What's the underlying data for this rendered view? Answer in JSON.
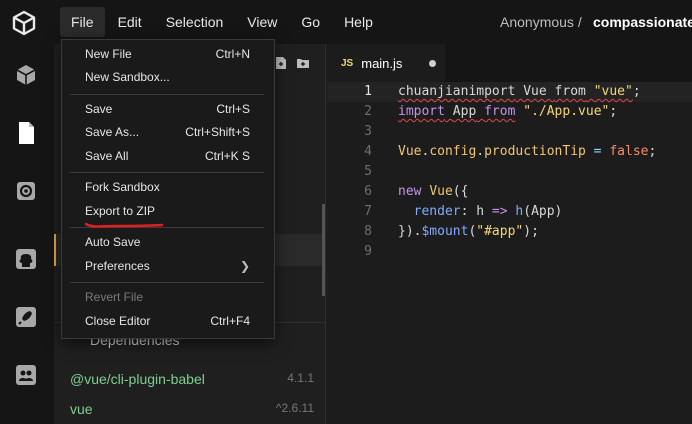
{
  "menubar": {
    "items": [
      "File",
      "Edit",
      "Selection",
      "View",
      "Go",
      "Help"
    ],
    "active": "File",
    "user": "Anonymous /",
    "sandbox": "compassionate-"
  },
  "activity": {
    "icons": [
      "cube-icon",
      "file-icon",
      "gear-icon",
      "github-icon",
      "rocket-icon",
      "users-icon"
    ]
  },
  "file_menu": {
    "new_file": {
      "label": "New File",
      "shortcut": "Ctrl+N"
    },
    "new_sandbox": {
      "label": "New Sandbox...",
      "shortcut": ""
    },
    "save": {
      "label": "Save",
      "shortcut": "Ctrl+S"
    },
    "save_as": {
      "label": "Save As...",
      "shortcut": "Ctrl+Shift+S"
    },
    "save_all": {
      "label": "Save All",
      "shortcut": "Ctrl+K S"
    },
    "fork_sandbox": {
      "label": "Fork Sandbox",
      "shortcut": ""
    },
    "export_zip": {
      "label": "Export to ZIP",
      "shortcut": ""
    },
    "auto_save": {
      "label": "Auto Save",
      "shortcut": ""
    },
    "preferences": {
      "label": "Preferences",
      "shortcut": ""
    },
    "revert_file": {
      "label": "Revert File",
      "shortcut": ""
    },
    "close_editor": {
      "label": "Close Editor",
      "shortcut": "Ctrl+F4"
    }
  },
  "sidebar": {
    "dependencies_title": "Dependencies",
    "dependencies": [
      {
        "name": "@vue/cli-plugin-babel",
        "version": "4.1.1"
      },
      {
        "name": "vue",
        "version": "^2.6.11"
      }
    ]
  },
  "editor": {
    "tab": {
      "icon": "JS",
      "label": "main.js"
    },
    "current_line": 1,
    "lines": [
      {
        "n": "1",
        "tokens": [
          {
            "t": "chuanjianimport",
            "c": "c-plain",
            "sq": true
          },
          {
            "t": " Vue ",
            "c": "c-plain",
            "sq": true
          },
          {
            "t": "from",
            "c": "c-plain",
            "sq": true
          },
          {
            "t": " ",
            "c": "c-plain",
            "sq": true
          },
          {
            "t": "\"vue\"",
            "c": "c-str",
            "sq": true
          },
          {
            "t": ";",
            "c": "c-plain"
          }
        ]
      },
      {
        "n": "2",
        "tokens": [
          {
            "t": "import",
            "c": "c-kw",
            "sq": true
          },
          {
            "t": " ",
            "c": "c-plain",
            "sq": true
          },
          {
            "t": "App",
            "c": "c-plain",
            "sq": true
          },
          {
            "t": " ",
            "c": "c-plain",
            "sq": true
          },
          {
            "t": "from",
            "c": "c-kw",
            "sq": true
          },
          {
            "t": " ",
            "c": "c-plain"
          },
          {
            "t": "\"./App.vue\"",
            "c": "c-str"
          },
          {
            "t": ";",
            "c": "c-plain"
          }
        ]
      },
      {
        "n": "3",
        "tokens": []
      },
      {
        "n": "4",
        "tokens": [
          {
            "t": "Vue",
            "c": "c-prop"
          },
          {
            "t": ".",
            "c": "c-plain"
          },
          {
            "t": "config",
            "c": "c-prop"
          },
          {
            "t": ".",
            "c": "c-plain"
          },
          {
            "t": "productionTip",
            "c": "c-prop"
          },
          {
            "t": " = ",
            "c": "c-op"
          },
          {
            "t": "false",
            "c": "c-lit"
          },
          {
            "t": ";",
            "c": "c-plain"
          }
        ]
      },
      {
        "n": "5",
        "tokens": []
      },
      {
        "n": "6",
        "tokens": [
          {
            "t": "new",
            "c": "c-kw"
          },
          {
            "t": " ",
            "c": "c-plain"
          },
          {
            "t": "Vue",
            "c": "c-prop"
          },
          {
            "t": "({",
            "c": "c-plain"
          }
        ]
      },
      {
        "n": "7",
        "tokens": [
          {
            "t": "  render",
            "c": "c-id"
          },
          {
            "t": ": ",
            "c": "c-plain"
          },
          {
            "t": "h",
            "c": "c-plain"
          },
          {
            "t": " => ",
            "c": "c-kw"
          },
          {
            "t": "h",
            "c": "c-id"
          },
          {
            "t": "(App)",
            "c": "c-plain"
          }
        ]
      },
      {
        "n": "8",
        "tokens": [
          {
            "t": "}).",
            "c": "c-plain"
          },
          {
            "t": "$mount",
            "c": "c-id"
          },
          {
            "t": "(",
            "c": "c-plain"
          },
          {
            "t": "\"#app\"",
            "c": "c-str"
          },
          {
            "t": ");",
            "c": "c-plain"
          }
        ]
      },
      {
        "n": "9",
        "tokens": []
      }
    ]
  },
  "colors": {
    "accent": "#e2a54a",
    "dependency": "#7fcf8f",
    "annotation": "#e02020"
  }
}
